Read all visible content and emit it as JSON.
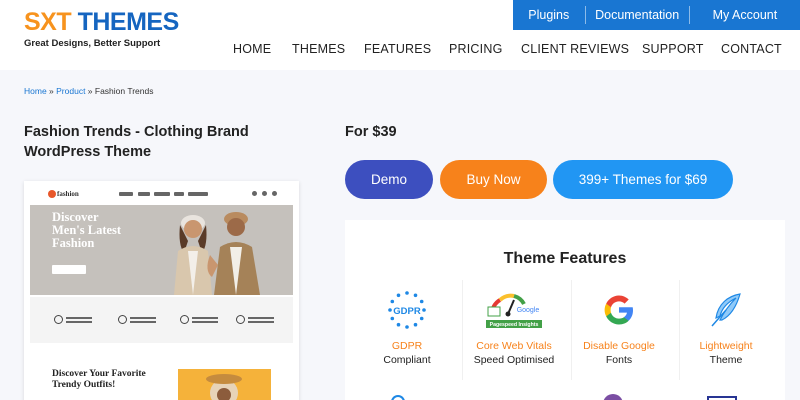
{
  "logo": {
    "sxt": "SXT",
    "themes": "THEMES",
    "tagline": "Great Designs, Better Support"
  },
  "topbar": {
    "links": [
      "Plugins",
      "Documentation",
      "My Account"
    ]
  },
  "nav": {
    "items": [
      "HOME",
      "THEMES",
      "FEATURES",
      "PRICING",
      "CLIENT REVIEWS",
      "SUPPORT",
      "CONTACT"
    ]
  },
  "breadcrumb": {
    "home": "Home",
    "sep1": " » ",
    "product": "Product",
    "sep2": " » ",
    "current": "Fashion Trends"
  },
  "product": {
    "title": "Fashion Trends - Clothing Brand WordPress Theme",
    "price": "For $39"
  },
  "buttons": {
    "demo": "Demo",
    "buy": "Buy Now",
    "all": "399+ Themes for $69"
  },
  "preview": {
    "logo": "fashion",
    "hero": [
      "Discover",
      "Men's Latest",
      "Fashion"
    ],
    "discover": [
      "Discover Your Favorite",
      "Trendy Outfits!"
    ]
  },
  "features": {
    "title": "Theme Features",
    "items": [
      {
        "icon": "gdpr-icon",
        "line1": "GDPR",
        "line2": "Compliant",
        "badge": "GDPR"
      },
      {
        "icon": "pagespeed-icon",
        "line1": "Core Web Vitals",
        "line2": "Speed Optimised",
        "badge_top": "Google",
        "badge_bottom": "Pagespeed Insights"
      },
      {
        "icon": "google-icon",
        "line1": "Disable Google",
        "line2": "Fonts",
        "badge": "G"
      },
      {
        "icon": "feather-icon",
        "line1": "Lightweight",
        "line2": "Theme"
      }
    ]
  },
  "colors": {
    "brand_orange": "#f7821b",
    "brand_blue": "#1976d2",
    "demo_button": "#3d4fbf",
    "all_button": "#2196f3"
  }
}
